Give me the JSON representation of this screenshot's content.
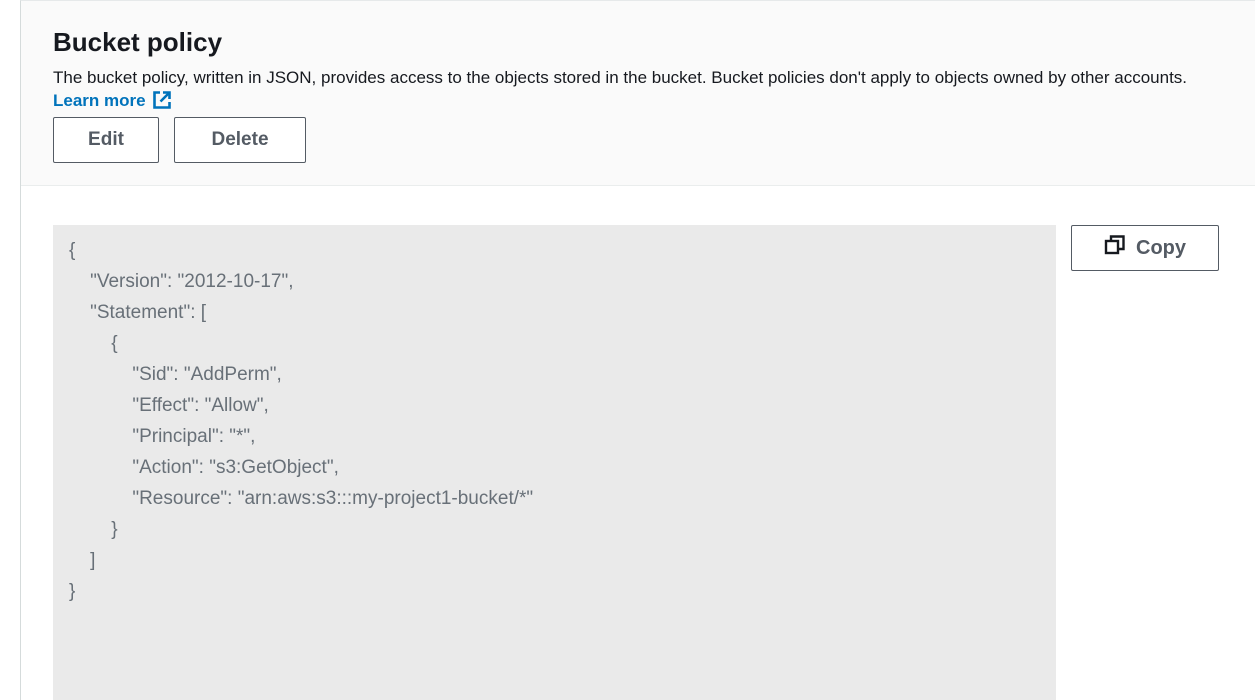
{
  "header": {
    "title": "Bucket policy",
    "description": "The bucket policy, written in JSON, provides access to the objects stored in the bucket. Bucket policies don't apply to objects owned by other accounts.",
    "learn_more": "Learn more"
  },
  "actions": {
    "edit_label": "Edit",
    "delete_label": "Delete"
  },
  "policy": {
    "copy_label": "Copy",
    "json_text": "{\n    \"Version\": \"2012-10-17\",\n    \"Statement\": [\n        {\n            \"Sid\": \"AddPerm\",\n            \"Effect\": \"Allow\",\n            \"Principal\": \"*\",\n            \"Action\": \"s3:GetObject\",\n            \"Resource\": \"arn:aws:s3:::my-project1-bucket/*\"\n        }\n    ]\n}"
  },
  "icons": {
    "external_link": "external-link-icon",
    "copy": "copy-icon"
  },
  "colors": {
    "link": "#0073bb",
    "button_border": "#545b64",
    "code_background": "#eaeaea",
    "code_text": "#687078"
  }
}
